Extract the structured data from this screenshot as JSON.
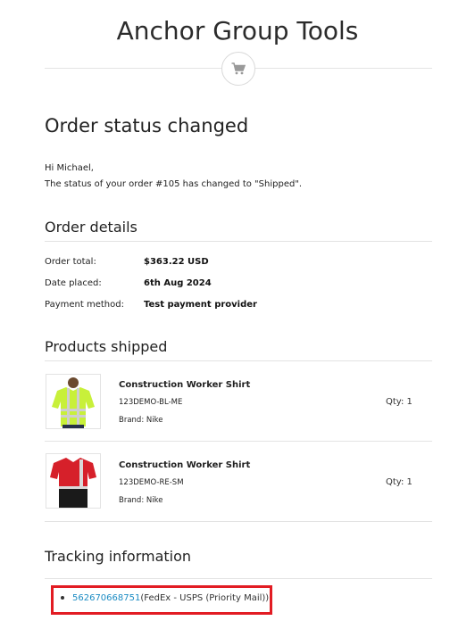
{
  "store": {
    "title": "Anchor Group Tools",
    "icon": "cart-icon"
  },
  "main": {
    "heading": "Order status changed",
    "greeting": "Hi Michael,",
    "message": "The status of your order #105 has changed to \"Shipped\"."
  },
  "order_details": {
    "heading": "Order details",
    "rows": [
      {
        "label": "Order total:",
        "value": "$363.22 USD"
      },
      {
        "label": "Date placed:",
        "value": "6th Aug 2024"
      },
      {
        "label": "Payment method:",
        "value": "Test payment provider"
      }
    ]
  },
  "products": {
    "heading": "Products shipped",
    "items": [
      {
        "name": "Construction Worker Shirt",
        "sku": "123DEMO-BL-ME",
        "brand": "Brand: Nike",
        "qty": "Qty: 1",
        "shirt_color": "#c8f03a"
      },
      {
        "name": "Construction Worker Shirt",
        "sku": "123DEMO-RE-SM",
        "brand": "Brand: Nike",
        "qty": "Qty: 1",
        "shirt_color": "#d6202a"
      }
    ]
  },
  "tracking": {
    "heading": "Tracking information",
    "number": "562670668751",
    "carrier": "(FedEx - USPS (Priority Mail))",
    "link_color": "#1a8bc3",
    "highlight_color": "#e21c23"
  }
}
